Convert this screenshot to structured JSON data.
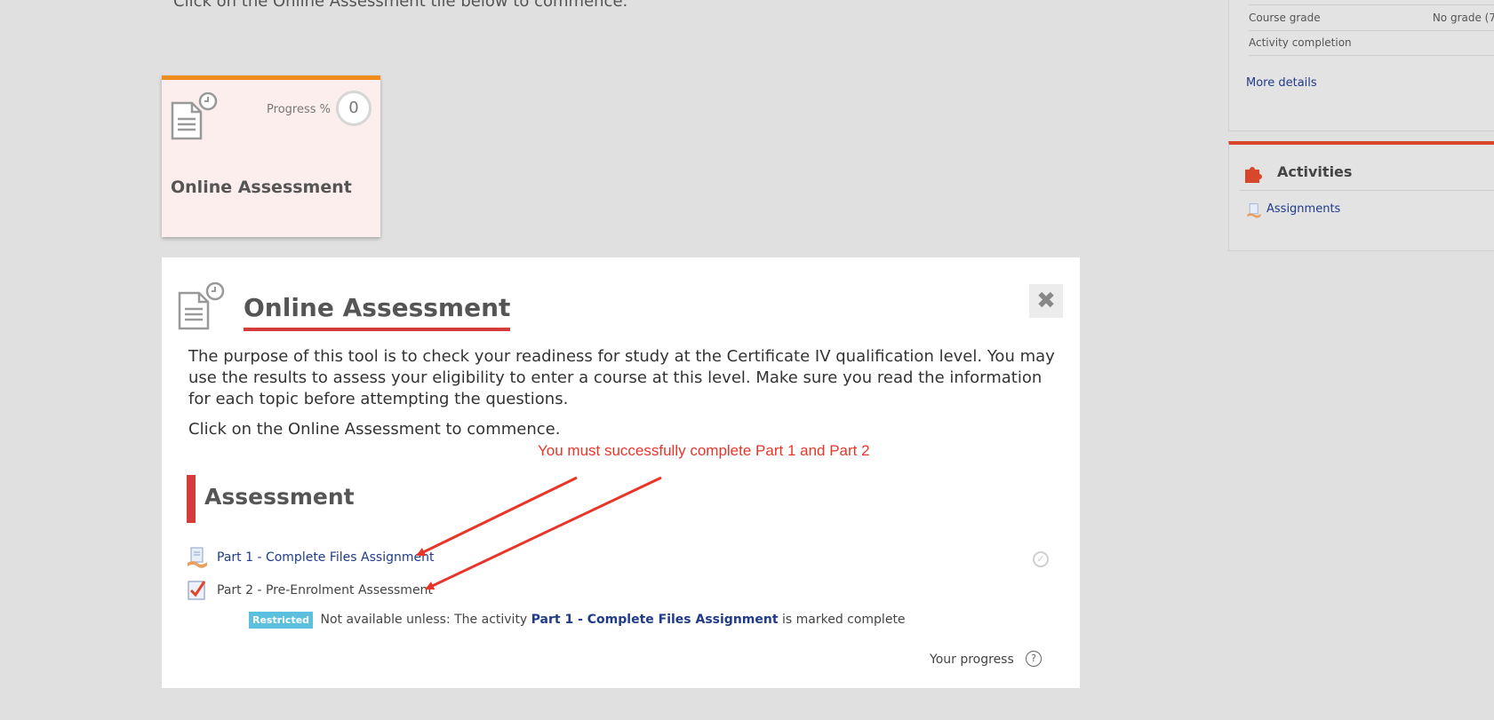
{
  "top_instruction": "Click on the Online Assessment tile below to commence.",
  "tile": {
    "progress_label": "Progress %",
    "progress_value": "0",
    "title": "Online Assessment",
    "accent_color": "#f08c1e"
  },
  "modal": {
    "title": "Online Assessment",
    "close_label": "✖",
    "description": "The purpose of this tool is to check your readiness for study at the Certificate IV qualification level. You may use the results to assess your eligibility to enter a course at this level.  Make sure you read the information for each topic before attempting the questions.",
    "description_2": "Click on the Online Assessment to commence.",
    "annotation": "You must successfully complete Part 1 and Part 2",
    "section_title": "Assessment",
    "activities": [
      {
        "label": "Part 1 - Complete Files Assignment",
        "icon": "assignment-icon"
      },
      {
        "label": "Part 2 - Pre-Enrolment Assessment",
        "icon": "quiz-icon"
      }
    ],
    "restriction": {
      "badge": "Restricted",
      "prefix": "Not available unless: The activity",
      "link": "Part 1 - Complete Files Assignment",
      "suffix": "is marked complete"
    },
    "progress_label": "Your progress",
    "help_label": "?"
  },
  "sidebar": {
    "grade_rows": [
      {
        "label": "Course grade",
        "value": "No grade (7"
      },
      {
        "label": "Activity completion",
        "value": ""
      }
    ],
    "more_details": "More details",
    "activities_title": "Activities",
    "activities_link": "Assignments"
  },
  "colors": {
    "accent_red": "#d63b3b",
    "annotation_red": "#e8352a",
    "link_blue": "#1f3b8a",
    "badge_blue": "#5bc0de"
  }
}
